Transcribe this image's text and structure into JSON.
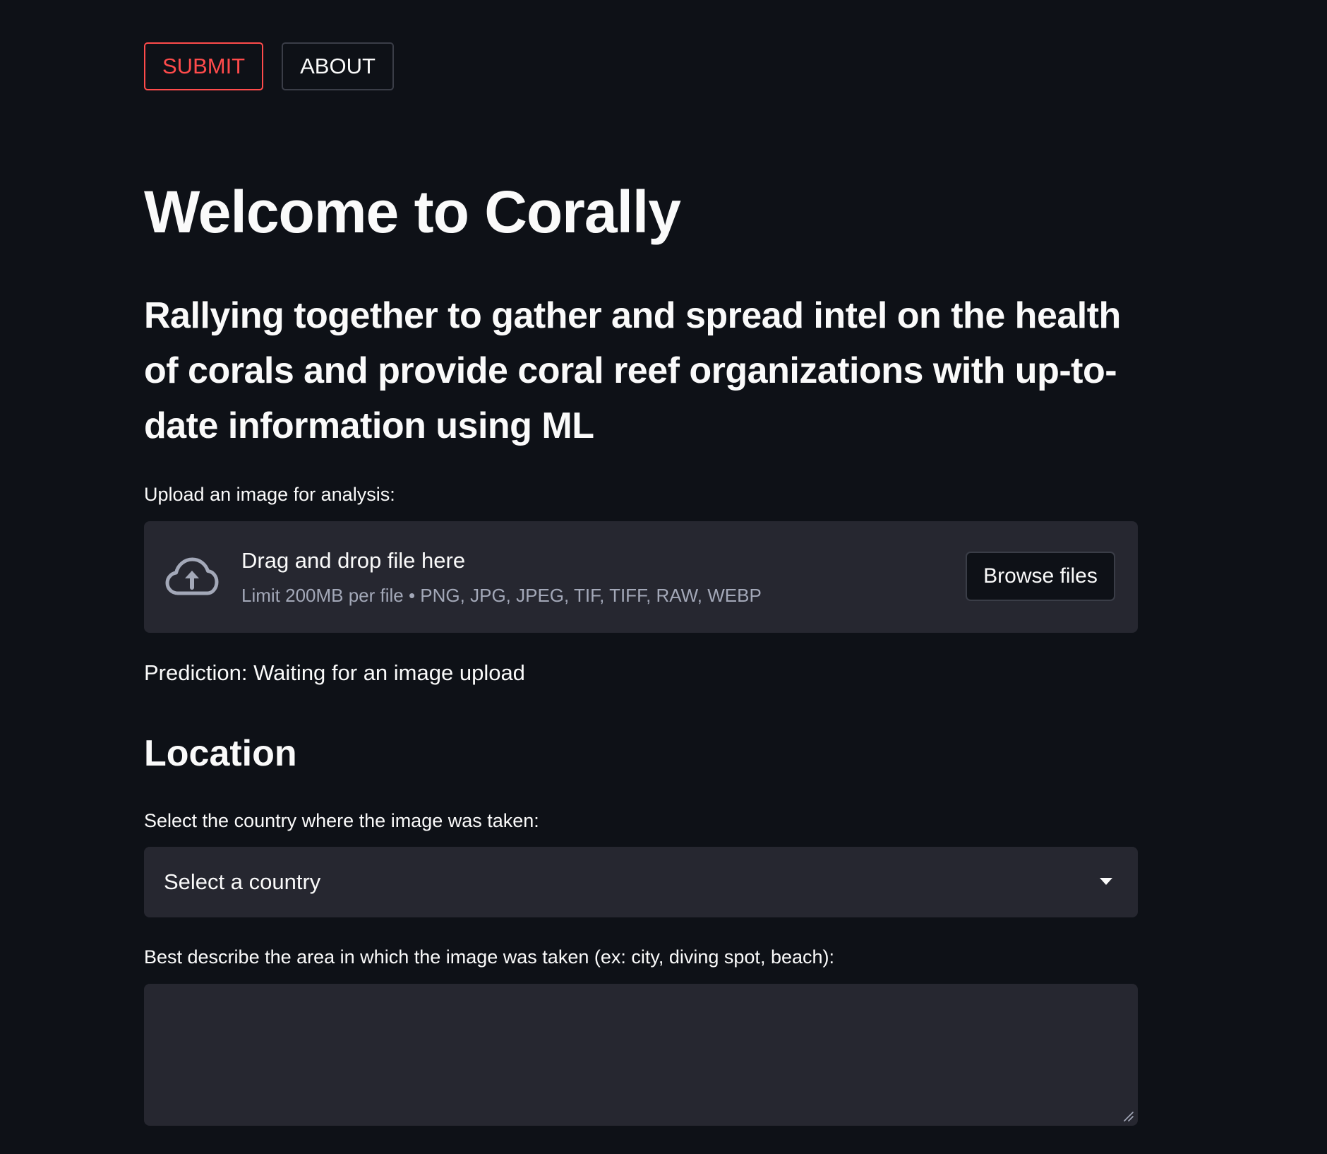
{
  "nav": {
    "submit_label": "SUBMIT",
    "about_label": "ABOUT"
  },
  "page": {
    "title": "Welcome to Corally",
    "subtitle": "Rallying together to gather and spread intel on the health of corals and provide coral reef organizations with up-to-date information using ML"
  },
  "uploader": {
    "label": "Upload an image for analysis:",
    "drop_title": "Drag and drop file here",
    "limit_text": "Limit 200MB per file • PNG, JPG, JPEG, TIF, TIFF, RAW, WEBP",
    "browse_label": "Browse files",
    "icon": "cloud-upload-icon"
  },
  "prediction": {
    "text": "Prediction: Waiting for an image upload"
  },
  "location": {
    "heading": "Location",
    "country_label": "Select the country where the image was taken:",
    "country_value": "Select a country",
    "area_label": "Best describe the area in which the image was taken (ex: city, diving spot, beach):",
    "area_value": ""
  },
  "colors": {
    "background": "#0e1117",
    "surface": "#262730",
    "accent": "#ff4b4b",
    "text": "#fafafa",
    "muted_text": "#a3a8b8",
    "border": "#3a3d47"
  }
}
